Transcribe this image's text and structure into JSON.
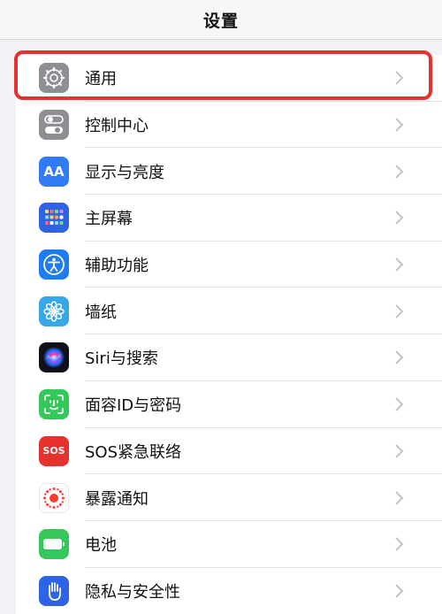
{
  "header": {
    "title": "设置"
  },
  "settings": {
    "items": [
      {
        "label": "通用",
        "icon": "gear-icon",
        "color": "#8e8e93"
      },
      {
        "label": "控制中心",
        "icon": "toggles-icon",
        "color": "#8e8e93"
      },
      {
        "label": "显示与亮度",
        "icon": "aa-text-icon",
        "color": "#2f7cf6",
        "glyph": "AA"
      },
      {
        "label": "主屏幕",
        "icon": "app-grid-icon",
        "color": "#2f63e6"
      },
      {
        "label": "辅助功能",
        "icon": "accessibility-icon",
        "color": "#1e7cf2"
      },
      {
        "label": "墙纸",
        "icon": "flower-icon",
        "color": "#37a7e8"
      },
      {
        "label": "Siri与搜索",
        "icon": "siri-icon",
        "color": "#1a1a2e"
      },
      {
        "label": "面容ID与密码",
        "icon": "face-id-icon",
        "color": "#34c759"
      },
      {
        "label": "SOS紧急联络",
        "icon": "sos-icon",
        "color": "#e5322d",
        "glyph": "SOS"
      },
      {
        "label": "暴露通知",
        "icon": "exposure-icon",
        "color": "#ffffff"
      },
      {
        "label": "电池",
        "icon": "battery-icon",
        "color": "#34c759"
      },
      {
        "label": "隐私与安全性",
        "icon": "privacy-hand-icon",
        "color": "#2f63e6"
      }
    ]
  },
  "highlight_color": "#e5322d"
}
